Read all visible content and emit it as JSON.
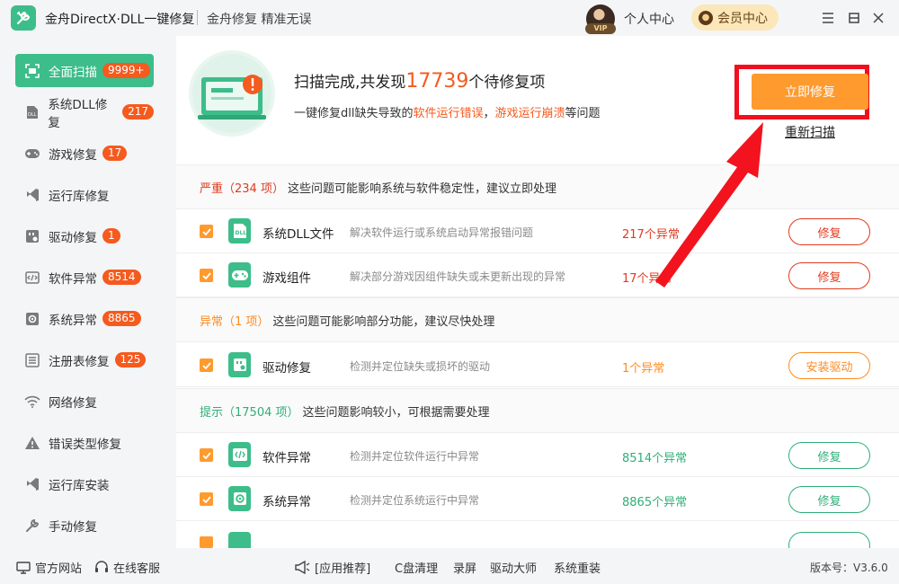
{
  "titlebar": {
    "app_title": "金舟DirectX·DLL一键修复",
    "slogan": "金舟修复 精准无误",
    "vip_label": "VIP",
    "user_center": "个人中心",
    "member_center": "会员中心"
  },
  "sidebar": {
    "items": [
      {
        "label": "全面扫描",
        "badge": "9999+",
        "icon": "scan-icon",
        "active": true
      },
      {
        "label": "系统DLL修复",
        "badge": "217",
        "icon": "dll-icon"
      },
      {
        "label": "游戏修复",
        "badge": "17",
        "icon": "gamepad-icon"
      },
      {
        "label": "运行库修复",
        "badge": "",
        "icon": "runtime-icon"
      },
      {
        "label": "驱动修复",
        "badge": "1",
        "icon": "driver-icon"
      },
      {
        "label": "软件异常",
        "badge": "8514",
        "icon": "code-icon"
      },
      {
        "label": "系统异常",
        "badge": "8865",
        "icon": "gear-icon"
      },
      {
        "label": "注册表修复",
        "badge": "125",
        "icon": "registry-icon"
      },
      {
        "label": "网络修复",
        "badge": "",
        "icon": "wifi-icon"
      },
      {
        "label": "错误类型修复",
        "badge": "",
        "icon": "warning-icon"
      },
      {
        "label": "运行库安装",
        "badge": "",
        "icon": "install-icon"
      },
      {
        "label": "手动修复",
        "badge": "",
        "icon": "wrench-icon"
      }
    ]
  },
  "hero": {
    "scan_prefix": "扫描完成,共发现",
    "scan_count": "17739",
    "scan_suffix": "个待修复项",
    "sub_prefix": "一键修复dll缺失导致的",
    "sub_hl1": "软件运行错误",
    "sub_comma": "，",
    "sub_hl2": "游戏运行崩溃",
    "sub_suffix": "等问题",
    "repair_label": "立即修复",
    "rescan_label": "重新扫描"
  },
  "sections": [
    {
      "title": "严重（234 项）",
      "desc": "这些问题可能影响系统与软件稳定性，建议立即处理",
      "color": "#e03a1e"
    },
    {
      "title": "异常（1 项）",
      "desc": "这些问题可能影响部分功能，建议尽快处理",
      "color": "#ff8a1e"
    },
    {
      "title": "提示（17504 项）",
      "desc": "这些问题影响较小，可根据需要处理",
      "color": "#2fae78"
    }
  ],
  "rows": [
    {
      "name": "系统DLL文件",
      "desc": "解决软件运行或系统启动异常报错问题",
      "count": "217个异常",
      "button": "修复",
      "icon": "dll-icon"
    },
    {
      "name": "游戏组件",
      "desc": "解决部分游戏因组件缺失或未更新出现的异常",
      "count": "17个异常",
      "button": "修复",
      "icon": "gamepad-icon"
    },
    {
      "name": "驱动修复",
      "desc": "检测并定位缺失或损坏的驱动",
      "count": "1个异常",
      "button": "安装驱动",
      "icon": "driver-icon"
    },
    {
      "name": "软件异常",
      "desc": "检测并定位软件运行中异常",
      "count": "8514个异常",
      "button": "修复",
      "icon": "code-icon"
    },
    {
      "name": "系统异常",
      "desc": "检测并定位系统运行中异常",
      "count": "8865个异常",
      "button": "修复",
      "icon": "gear-icon"
    }
  ],
  "colors": {
    "accent": "#3dbd8a",
    "severe": "#e03a1e",
    "warning": "#ff8a1e",
    "hint": "#2fae78",
    "repair_button": "#ff9a2e",
    "annotation": "#f20f1d"
  },
  "footer": {
    "official_site": "官方网站",
    "online_service": "在线客服",
    "recommend": "[应用推荐]",
    "links": [
      "C盘清理",
      "录屏",
      "驱动大师",
      "系统重装"
    ],
    "version": "版本号：V3.6.0"
  }
}
